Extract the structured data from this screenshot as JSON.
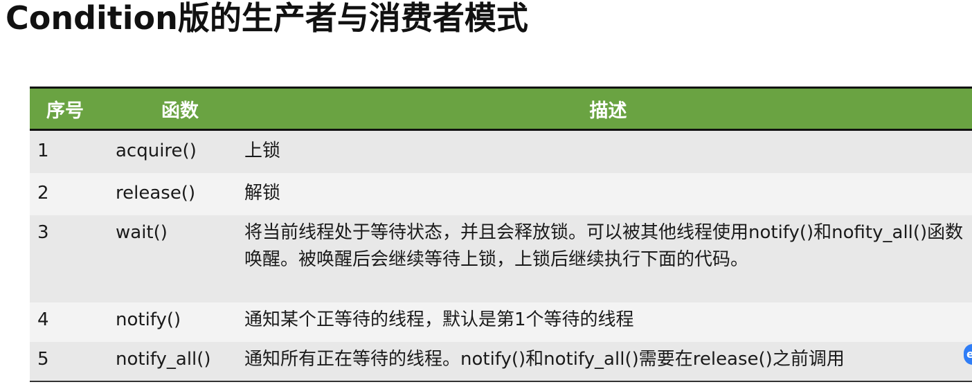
{
  "title": "Condition版的生产者与消费者模式",
  "table": {
    "headers": {
      "no": "序号",
      "func": "函数",
      "desc": "描述"
    },
    "rows": [
      {
        "no": "1",
        "func": "acquire()",
        "desc": "上锁"
      },
      {
        "no": "2",
        "func": "release()",
        "desc": "解锁"
      },
      {
        "no": "3",
        "func": "wait()",
        "desc": "将当前线程处于等待状态，并且会释放锁。可以被其他线程使用notify()和nofity_all()函数唤醒。被唤醒后会继续等待上锁，上锁后继续执行下面的代码。"
      },
      {
        "no": "4",
        "func": "notify()",
        "desc": "通知某个正等待的线程，默认是第1个等待的线程"
      },
      {
        "no": "5",
        "func": "notify_all()",
        "desc": "通知所有正在等待的线程。notify()和notify_all()需要在release()之前调用"
      }
    ]
  },
  "colors": {
    "header_bg": "#6aa342",
    "row_odd": "#e8e8e8",
    "row_even": "#f3f3f3",
    "badge": "#2f7df6"
  },
  "edge_badge_icon": "floating-assistant-icon"
}
